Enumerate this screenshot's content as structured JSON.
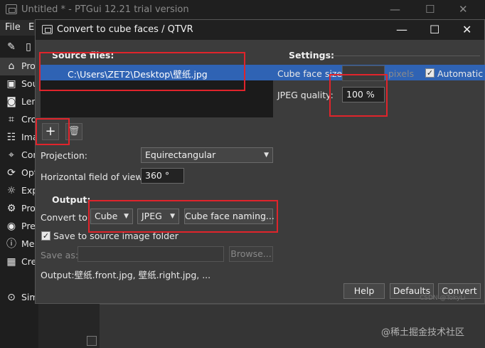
{
  "main_window": {
    "title": "Untitled * - PTGui 12.21 trial version",
    "controls": {
      "minimize": "—",
      "maximize": "☐",
      "close": "✕"
    },
    "menu": [
      "File",
      "E"
    ],
    "sidebar": [
      {
        "icon": "edit-icon",
        "glyph": "✎",
        "label": ""
      },
      {
        "icon": "document-icon",
        "glyph": "▯",
        "label": ""
      },
      {
        "icon": "home-icon",
        "glyph": "⌂",
        "label": "Pro"
      },
      {
        "icon": "image-icon",
        "glyph": "▣",
        "label": "Sou"
      },
      {
        "icon": "camera-icon",
        "glyph": "◙",
        "label": "Len"
      },
      {
        "icon": "crop-icon",
        "glyph": "⌗",
        "label": "Cro"
      },
      {
        "icon": "sliders-icon",
        "glyph": "☷",
        "label": "Ima"
      },
      {
        "icon": "map-pin-icon",
        "glyph": "⌖",
        "label": "Cor"
      },
      {
        "icon": "refresh-icon",
        "glyph": "⟳",
        "label": "Opt"
      },
      {
        "icon": "sun-icon",
        "glyph": "☼",
        "label": "Exp"
      },
      {
        "icon": "gear-icon",
        "glyph": "⚙",
        "label": "Pro"
      },
      {
        "icon": "eye-icon",
        "glyph": "◉",
        "label": "Pre"
      },
      {
        "icon": "info-icon",
        "glyph": "ⓘ",
        "label": "Me"
      },
      {
        "icon": "grid-icon",
        "glyph": "▦",
        "label": "Cre"
      },
      {
        "icon": "circle-up-icon",
        "glyph": "⊙",
        "label": "Sim"
      }
    ]
  },
  "dialog": {
    "title": "Convert to cube faces / QTVR",
    "controls": {
      "minimize": "—",
      "maximize": "☐",
      "close": "✕"
    },
    "source_files": {
      "heading": "Source files:",
      "items": [
        "C:\\Users\\ZET2\\Desktop\\壁纸.jpg"
      ],
      "add_glyph": "+",
      "delete_glyph": "🗑"
    },
    "settings": {
      "heading": "Settings:",
      "cube_face_size_label": "Cube face size:",
      "cube_face_size_value": "",
      "cube_face_size_unit": "pixels",
      "automatic_label": "Automatic",
      "automatic_checked": true,
      "jpeg_quality_label": "JPEG quality:",
      "jpeg_quality_value": "100 %"
    },
    "projection": {
      "label": "Projection:",
      "value": "Equirectangular"
    },
    "hfov": {
      "label": "Horizontal field of view:",
      "value": "360 °"
    },
    "output": {
      "heading": "Output:",
      "convert_to_label": "Convert to:",
      "convert_to_value": "Cube",
      "format_value": "JPEG",
      "naming_button": "Cube face naming...",
      "save_to_source_label": "Save to source image folder",
      "save_to_source_checked": true,
      "save_as_label": "Save as:",
      "save_as_value": "",
      "browse_button": "Browse...",
      "output_summary": "Output:壁纸.front.jpg, 壁纸.right.jpg, ..."
    },
    "buttons": {
      "help": "Help",
      "defaults": "Defaults",
      "convert": "Convert"
    }
  },
  "watermark": {
    "main": "@稀土掘金技术社区",
    "small": "CSDN @TokyLi"
  },
  "annotation_color": "#e0242b"
}
